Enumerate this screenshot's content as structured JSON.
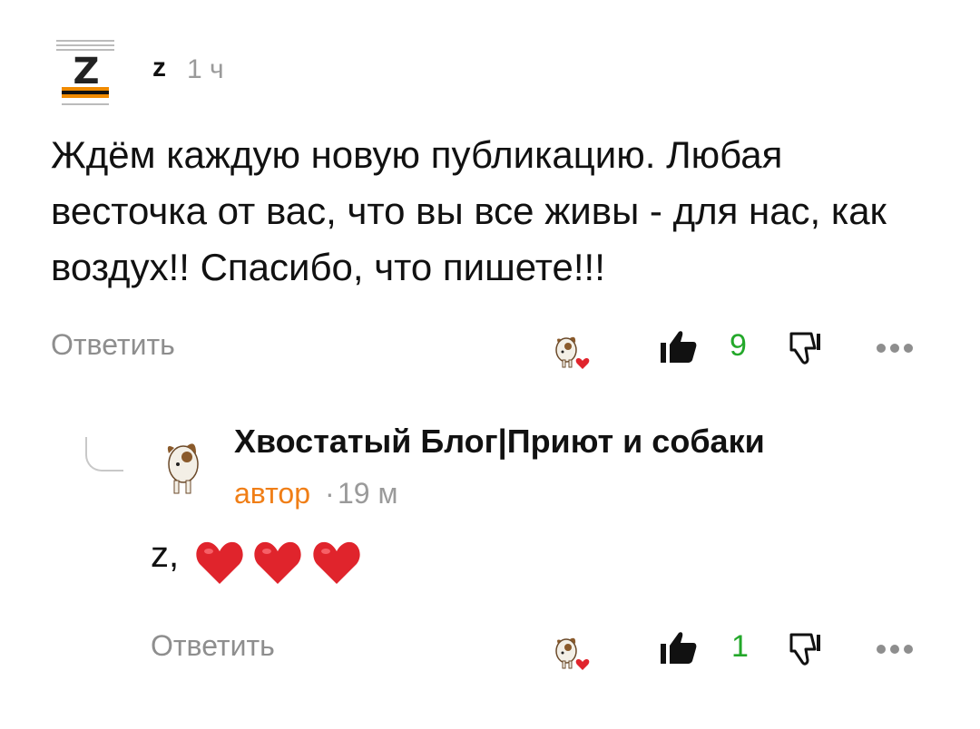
{
  "top_comment": {
    "author": "z",
    "time": "1 ч",
    "text": "Ждём каждую новую публикацию. Любая весточка от вас, что вы все живы - для нас, как воздух!! Спасибо, что пишете!!!",
    "reply_label": "Ответить",
    "like_count": "9",
    "avatar_letter": "Z"
  },
  "reply": {
    "author": "Хвостатый Блог|Приют и собаки",
    "role": "автор",
    "separator": "·",
    "time": "19 м",
    "text_prefix": "z,",
    "hearts": 3,
    "reply_label": "Ответить",
    "like_count": "1"
  },
  "colors": {
    "accent_orange": "#f07e16",
    "like_green": "#23a82a",
    "muted": "#8e8e8e",
    "heart_red": "#e0242c"
  },
  "icons": {
    "reaction": "dog-heart-icon",
    "like": "thumbs-up-icon",
    "dislike": "thumbs-down-icon",
    "more": "more-dots-icon"
  }
}
